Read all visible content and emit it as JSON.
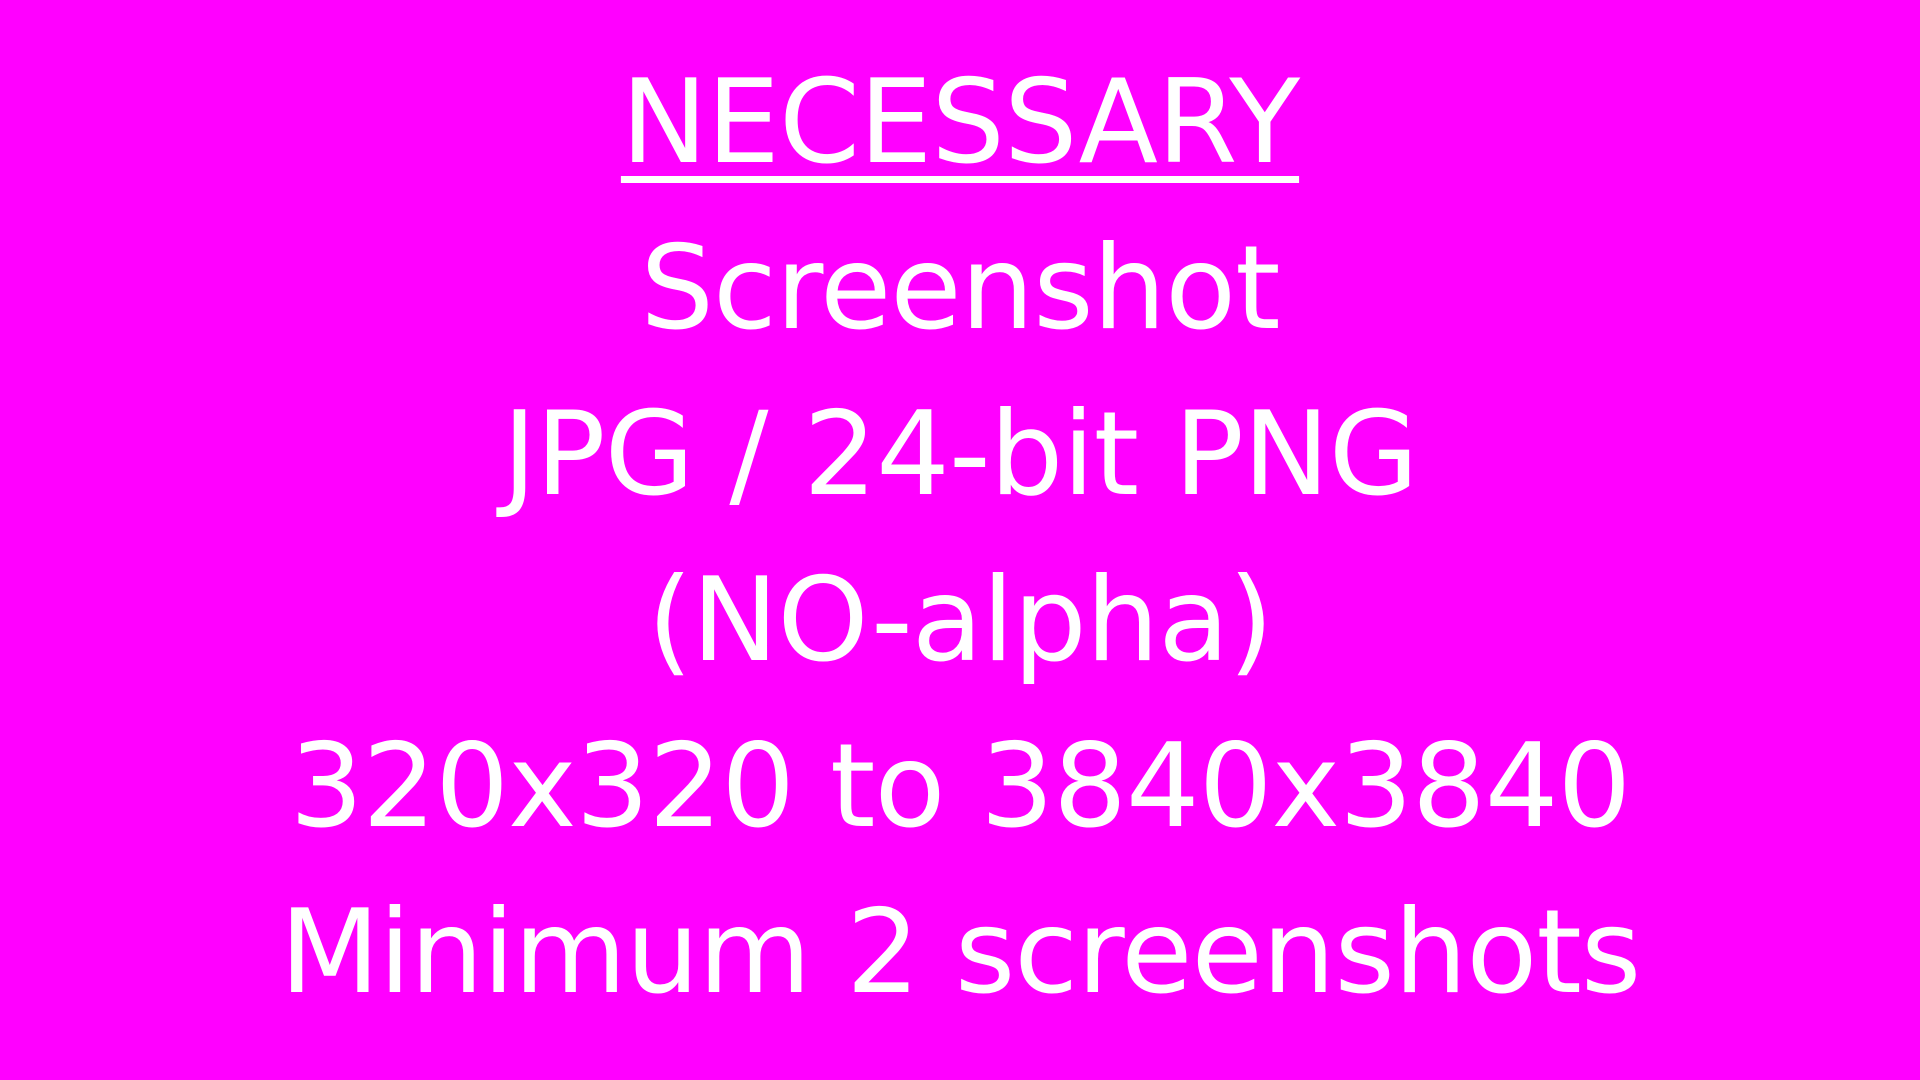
{
  "slide": {
    "background_color": "#FF00FF",
    "text_color": "#FFFFFF",
    "heading": "NECESSARY",
    "lines": [
      "Screenshot",
      "JPG / 24-bit PNG",
      "(NO-alpha)",
      "320x320 to 3840x3840",
      "Minimum 2 screenshots"
    ]
  }
}
